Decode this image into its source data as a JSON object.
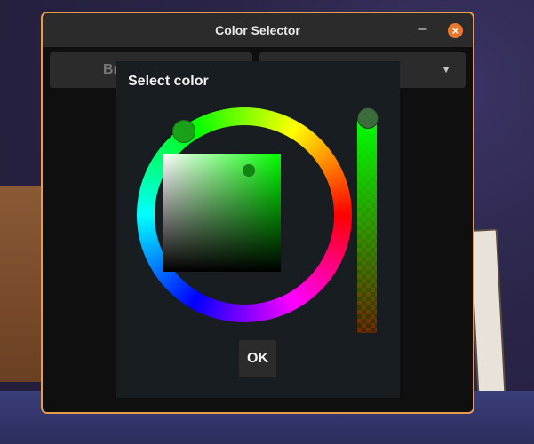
{
  "window": {
    "title": "Color Selector"
  },
  "background_controls": {
    "field_text": "Br",
    "dropdown_icon": "chevron-down-icon"
  },
  "dialog": {
    "title": "Select color",
    "ok_label": "OK"
  },
  "colors": {
    "accent_border": "#e99a4c",
    "close_button": "#e8782f",
    "selected_color": "#00ff00",
    "marker_color": "#0a8a0a"
  },
  "icons": {
    "minimize": "minimize-icon",
    "close": "close-icon"
  }
}
